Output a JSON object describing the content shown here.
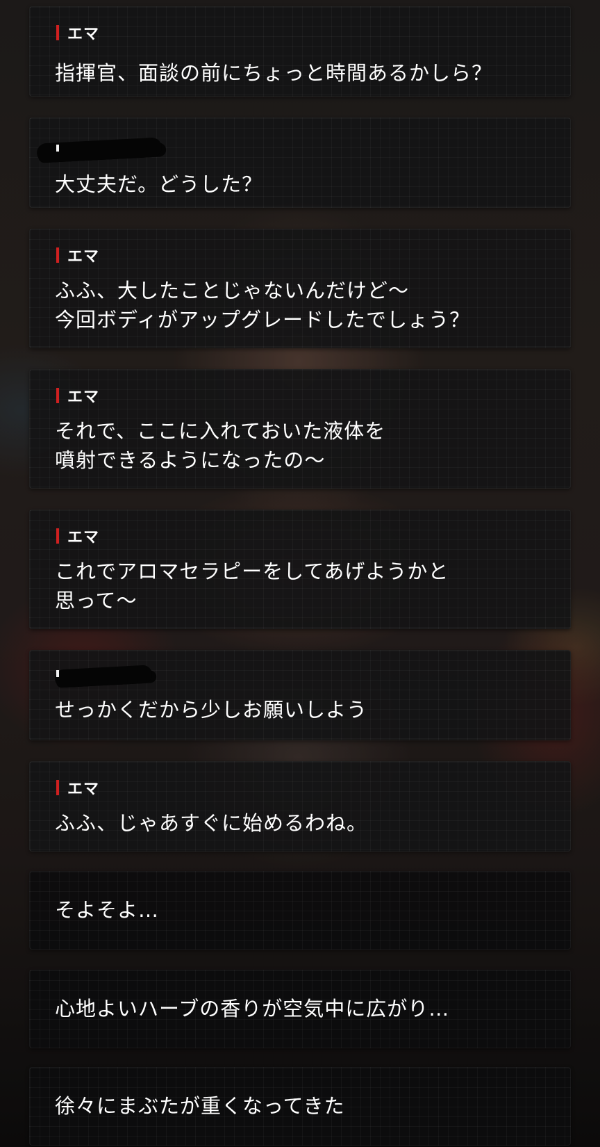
{
  "dialogue": [
    {
      "kind": "dialogue",
      "speaker": "エマ",
      "lines": [
        "指揮官、面談の前にちょっと時間あるかしら？"
      ]
    },
    {
      "kind": "dialogue",
      "speaker": "",
      "lines": [
        "大丈夫だ。どうした？"
      ]
    },
    {
      "kind": "dialogue",
      "speaker": "エマ",
      "lines": [
        "ふふ、大したことじゃないんだけど～",
        "今回ボディがアップグレードしたでしょう？"
      ]
    },
    {
      "kind": "dialogue",
      "speaker": "エマ",
      "lines": [
        "それで、ここに入れておいた液体を",
        "噴射できるようになったの～"
      ]
    },
    {
      "kind": "dialogue",
      "speaker": "エマ",
      "lines": [
        "これでアロマセラピーをしてあげようかと",
        "思って～"
      ]
    },
    {
      "kind": "dialogue",
      "speaker": "",
      "lines": [
        "せっかくだから少しお願いしよう"
      ]
    },
    {
      "kind": "dialogue",
      "speaker": "エマ",
      "lines": [
        "ふふ、じゃあすぐに始めるわね。"
      ]
    },
    {
      "kind": "narration",
      "speaker": "",
      "lines": [
        "そよそよ…"
      ]
    },
    {
      "kind": "narration",
      "speaker": "",
      "lines": [
        "心地よいハーブの香りが空気中に広がり…"
      ]
    },
    {
      "kind": "narration",
      "speaker": "",
      "lines": [
        "徐々にまぶたが重くなってきた"
      ]
    }
  ],
  "colors": {
    "speaker_accent": "#d02020",
    "text": "#ffffff",
    "box_background": "#141415"
  }
}
